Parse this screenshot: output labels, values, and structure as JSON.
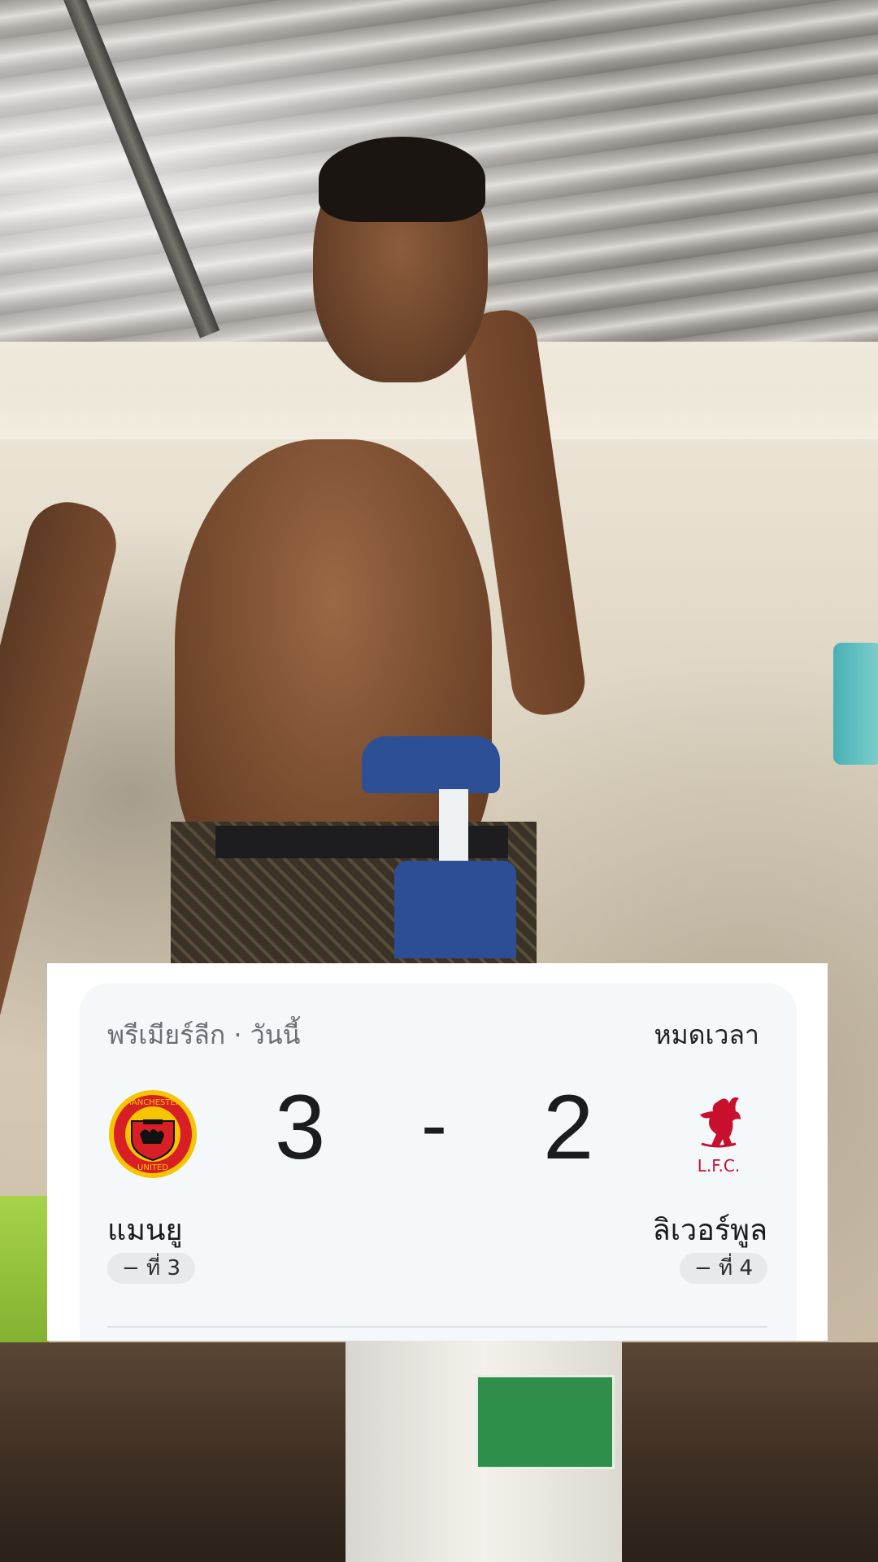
{
  "match_card": {
    "league": "พรีเมียร์ลีก · วันนี้",
    "status": "หมดเวลา",
    "home": {
      "name": "แมนยู",
      "rank": "− ที่ 3",
      "score": "3",
      "crest_icon": "manchester-united-crest",
      "crest_text_top": "MANCHESTER",
      "crest_text_bottom": "UNITED"
    },
    "away": {
      "name": "ลิเวอร์พูล",
      "rank": "− ที่ 4",
      "score": "2",
      "crest_icon": "liverpool-liverbird-crest",
      "crest_text": "L.F.C."
    },
    "separator": "-"
  },
  "colors": {
    "card_bg": "#f4f8fa",
    "mu_red": "#d81f26",
    "mu_gold": "#f6c500",
    "lfc_red": "#c8102e"
  }
}
